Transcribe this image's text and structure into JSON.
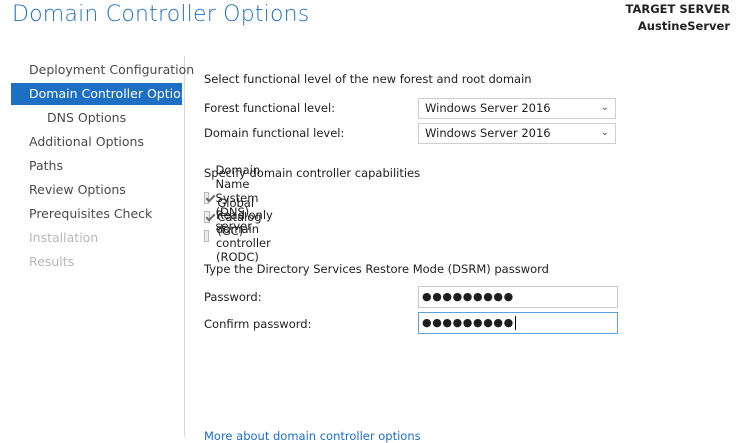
{
  "header": {
    "title": "Domain Controller Options",
    "target_label": "TARGET SERVER",
    "target_name": "AustineServer"
  },
  "nav": {
    "items": [
      {
        "label": "Deployment Configuration",
        "state": "normal"
      },
      {
        "label": "Domain Controller Options",
        "state": "active"
      },
      {
        "label": "DNS Options",
        "state": "normal"
      },
      {
        "label": "Additional Options",
        "state": "normal"
      },
      {
        "label": "Paths",
        "state": "normal"
      },
      {
        "label": "Review Options",
        "state": "normal"
      },
      {
        "label": "Prerequisites Check",
        "state": "normal"
      },
      {
        "label": "Installation",
        "state": "disabled"
      },
      {
        "label": "Results",
        "state": "disabled"
      }
    ]
  },
  "functional": {
    "heading": "Select functional level of the new forest and root domain",
    "forest_label": "Forest functional level:",
    "forest_value": "Windows Server 2016",
    "domain_label": "Domain functional level:",
    "domain_value": "Windows Server 2016"
  },
  "capabilities": {
    "heading": "Specify domain controller capabilities",
    "options": [
      {
        "label": "Domain Name System (DNS) server",
        "checked": true
      },
      {
        "label": "Global Catalog (GC)",
        "checked": true
      },
      {
        "label": "Read only domain controller (RODC)",
        "checked": false
      }
    ]
  },
  "dsrm": {
    "heading": "Type the Directory Services Restore Mode (DSRM) password",
    "password_label": "Password:",
    "password_value": "●●●●●●●●●",
    "confirm_label": "Confirm password:",
    "confirm_value": "●●●●●●●●●"
  },
  "footer": {
    "link": "More about domain controller options"
  },
  "colors": {
    "accent": "#1c6fc2",
    "title": "#1e72c2",
    "disabled": "#b8b8b8"
  },
  "icons": {
    "dropdown": "chevron-down-icon",
    "checkbox": "checkmark-icon"
  }
}
